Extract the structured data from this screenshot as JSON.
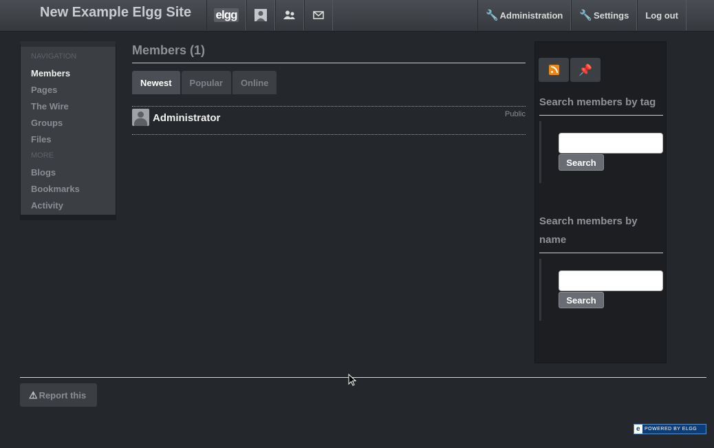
{
  "site": {
    "title": "New Example Elgg Site"
  },
  "topbar": {
    "elgg_logo": "elgg",
    "icons": [
      "profile-icon",
      "friends-icon",
      "messages-icon"
    ],
    "administration": "Administration",
    "settings": "Settings",
    "logout": "Log out"
  },
  "sidebar": {
    "nav_header": "NAVIGATION",
    "items": [
      "Members",
      "Pages",
      "The Wire",
      "Groups",
      "Files"
    ],
    "more_header": "MORE",
    "more_items": [
      "Blogs",
      "Bookmarks",
      "Activity"
    ],
    "active": "Members"
  },
  "main": {
    "title": "Members (1)",
    "tabs": [
      "Newest",
      "Popular",
      "Online"
    ],
    "active_tab": "Newest",
    "members": [
      {
        "name": "Administrator",
        "access": "Public"
      }
    ]
  },
  "rightbar": {
    "icons": [
      "rss-icon",
      "pin-icon"
    ],
    "tag_search_title": "Search members by tag",
    "name_search_title": "Search members by name",
    "search_button": "Search",
    "tag_search_value": "",
    "name_search_value": ""
  },
  "footer": {
    "report": "Report this",
    "powered": "POWERED BY ELGG",
    "powered_badge": "e"
  },
  "colors": {
    "page_bg": "#24272c",
    "rss": "#e9881b",
    "pin": "#4aa3e6",
    "powered_bg": "#0b3d7a"
  }
}
